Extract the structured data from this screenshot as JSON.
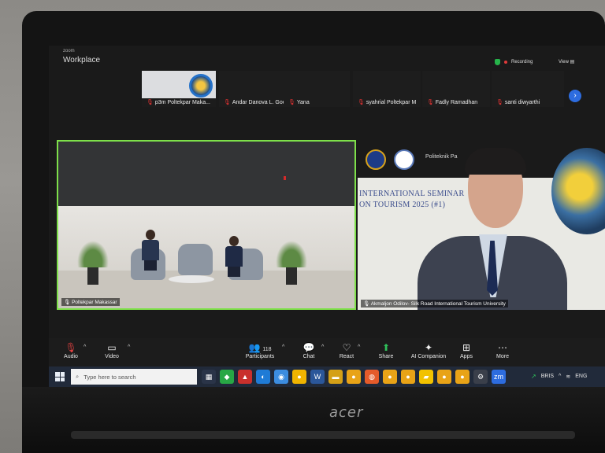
{
  "app": {
    "title_small": "zoom",
    "title": "Workplace"
  },
  "status": {
    "recording_label": "Recording",
    "view_label": "View"
  },
  "participants_strip": [
    {
      "name": "p3m Poltekpar Maka..."
    },
    {
      "name": "Andar Danova L. Goel..."
    },
    {
      "name": "Yana"
    },
    {
      "name": "syahrial Poltekpar M"
    },
    {
      "name": "Fadly Ramadhan"
    },
    {
      "name": "santi diwyarthi"
    }
  ],
  "tiles": {
    "left": {
      "name": "Poltekpar Makassar"
    },
    "right": {
      "name": "Akmaljon Odilov- Silk Road International Tourism University",
      "banner_org": "Politeknik Pa",
      "banner_line1": "INTERNATIONAL SEMINAR",
      "banner_line2": "ON TOURISM 2025 (#1)"
    }
  },
  "toolbar": {
    "audio": "Audio",
    "video": "Video",
    "participants": "Participants",
    "participants_count": "118",
    "chat": "Chat",
    "react": "React",
    "share": "Share",
    "ai": "AI Companion",
    "apps": "Apps",
    "more": "More"
  },
  "taskbar": {
    "search_placeholder": "Type here to search",
    "stock": "BRIS",
    "lang": "ENG"
  },
  "laptop": {
    "brand": "acer"
  },
  "colors": {
    "active_speaker_border": "#7ee04a",
    "accent_blue": "#2d6cdf",
    "taskbar": "#212a3a"
  }
}
